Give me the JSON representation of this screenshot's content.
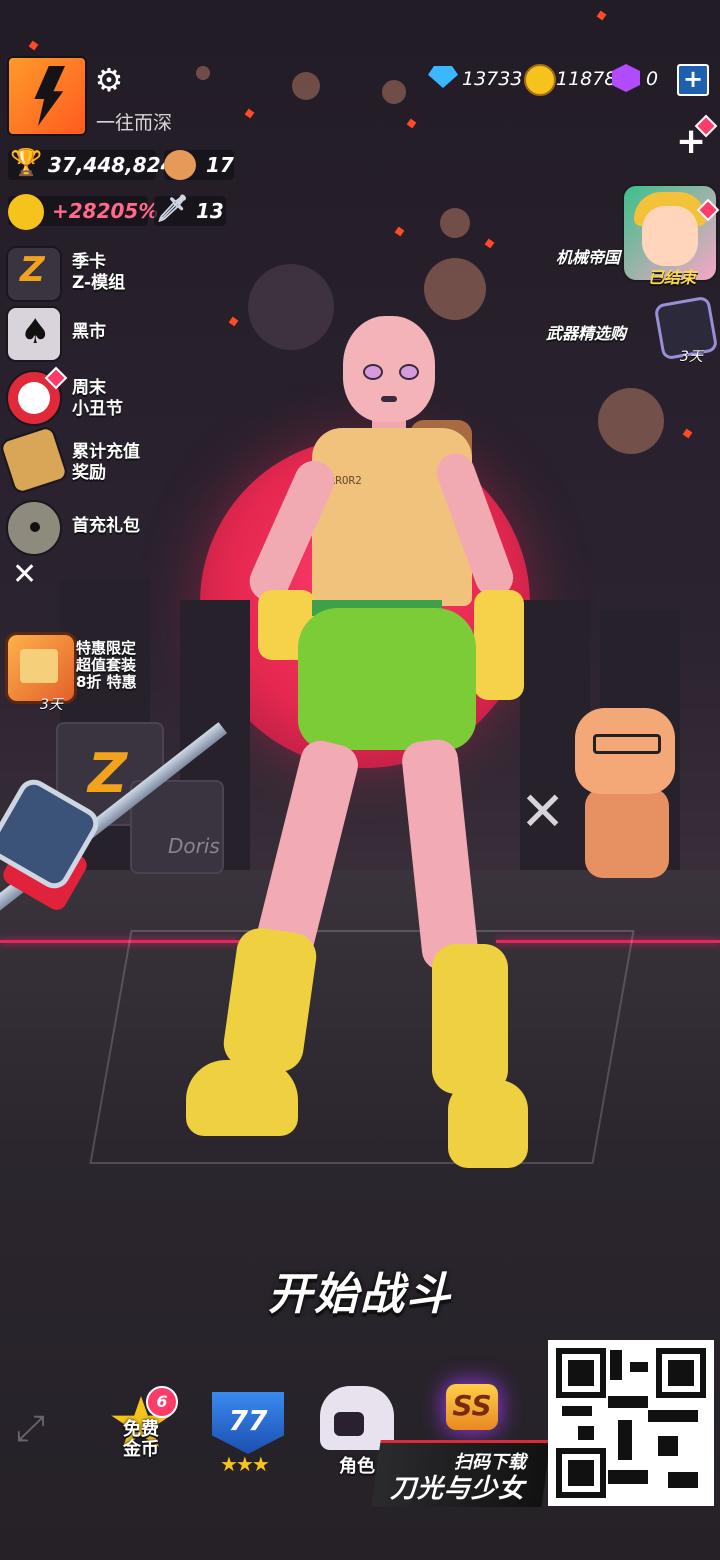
{
  "player": {
    "nickname": "一往而深",
    "trophies": "37,448,824",
    "bear_count": "17",
    "ranking_bonus": "+28205%",
    "sword_count": "13"
  },
  "currencies": {
    "gems": "13733",
    "coins": "11878",
    "cubes": "0"
  },
  "left_menu": [
    {
      "icon": "season-pass-icon",
      "label": "季卡\nZ-模组"
    },
    {
      "icon": "black-market-icon",
      "label": "黑市"
    },
    {
      "icon": "clown-icon",
      "label": "周末\n小丑节"
    },
    {
      "icon": "sale-tag-icon",
      "label": "累计充值\n奖励"
    },
    {
      "icon": "first-charge-icon",
      "label": "首充礼包"
    }
  ],
  "promo": {
    "label": "特惠限定\n超值套装\n8折 特惠",
    "days": "3天"
  },
  "events": {
    "mech_empire": {
      "title": "机械帝国",
      "status": "已结束"
    },
    "weapon_select": {
      "title": "武器精选购",
      "days": "3天"
    }
  },
  "character": {
    "shirt_text": "ERROR2",
    "crate_text": "Doris"
  },
  "start_label": "开始战斗",
  "bottom_nav": {
    "free_coins": {
      "label": "免费\n金币",
      "badge": "6"
    },
    "level": {
      "value": "77"
    },
    "role": {
      "label": "角色"
    },
    "ss_label": "SS"
  },
  "banner": {
    "sub": "扫码下载",
    "main": "刀光与少女"
  },
  "colors": {
    "accent_red": "#e3265c",
    "moon": "#ff3d6e",
    "badge_pink": "#ff3b6a",
    "gem_blue": "#39b8ff",
    "coin_gold": "#f6c21c",
    "cube_purple": "#b14bff"
  }
}
